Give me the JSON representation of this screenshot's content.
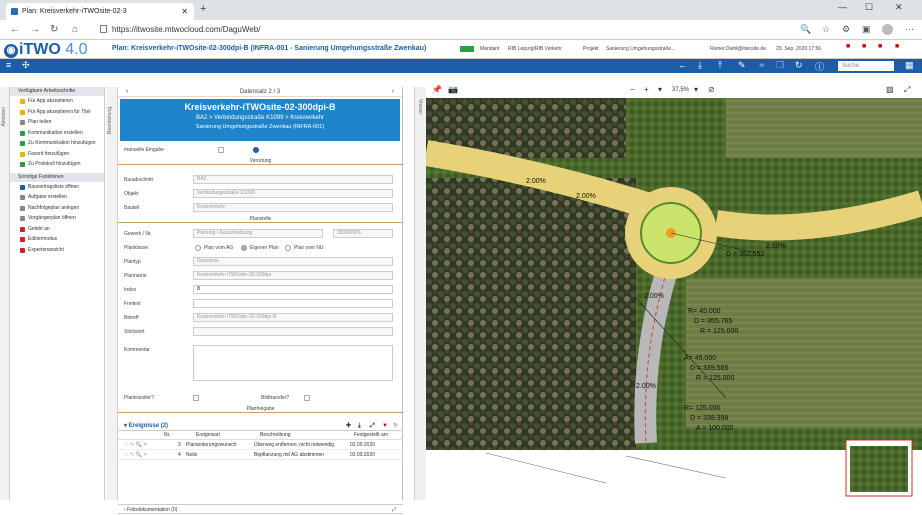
{
  "browser": {
    "tab_title": "Plan: Kreisverkehr-iTWOsite-02-3",
    "url": "https://itwosite.mtwocloud.com/DaguWeb/"
  },
  "app": {
    "logo_text": "iTWO",
    "logo_version": "4.0",
    "plan_title": "Plan: Kreisverkehr-iTWOsite-02-300dpi-B (INFRA-001 - Sanierung Umgehungsstraße Zwenkau)",
    "mandant_label": "Mandant",
    "mandant_value": "RIB Leipzig/RIB Verkehr",
    "projekt_label": "Projekt",
    "projekt_value": "Sanierung Umgehungsstraße...",
    "user": "Reiner.Diehl@itwosite.de",
    "date": "29. Sep. 2020 17:56",
    "search_placeholder": "Suche"
  },
  "left_strip": {
    "label": "Aktionen"
  },
  "form_strip": {
    "label": "Bearbeitung"
  },
  "map_strip": {
    "label": "Viewer"
  },
  "actions": {
    "head1": "Verfügbare Arbeitsschritte",
    "items1": [
      {
        "label": "Für App akzeptieren",
        "color": "#e8b400"
      },
      {
        "label": "Für App akzeptieren für Titel",
        "color": "#e8b400"
      },
      {
        "label": "Plan teilen",
        "color": "#888888"
      },
      {
        "label": "Kommunikation erstellen",
        "color": "#2e9e3c"
      },
      {
        "label": "Zu Kommunikation hinzufügen",
        "color": "#2e9e3c"
      },
      {
        "label": "Favorit hinzufügen",
        "color": "#e8b400"
      },
      {
        "label": "Zu Protokoll hinzufügen",
        "color": "#2e9e3c"
      }
    ],
    "head2": "Sonstige Funktionen",
    "items2": [
      {
        "label": "Bauvertragsliste öffnen",
        "color": "#1c5da8"
      },
      {
        "label": "Aufgabe erstellen",
        "color": "#888888"
      },
      {
        "label": "Nachfolgeplan anlegen",
        "color": "#888888"
      },
      {
        "label": "Vorgängerplan öffnen",
        "color": "#888888"
      },
      {
        "label": "Gelebt an",
        "color": "#cc2222"
      },
      {
        "label": "Editiermodus",
        "color": "#cc2222"
      },
      {
        "label": "Expertenansicht",
        "color": "#cc2222"
      }
    ]
  },
  "form": {
    "datensatz": "Datensatz 2 / 3",
    "title": "Kreisverkehr-iTWOsite-02-300dpi-B",
    "path": "BA2 > Verbindungsstraße K1099 > Kreisverkehr",
    "subtitle": "Sanierung Umgehungsstraße Zwenkau (INFRA-001)",
    "manual_label": "manuelle Eingabe",
    "section_verortung": "Verortung",
    "bauabschnitt_label": "Bauabschnitt",
    "bauabschnitt_value": "BA2",
    "objekt_label": "Objekt",
    "objekt_value": "Verbindungsstraße K1099",
    "bauteil_label": "Bauteil",
    "bauteil_value": "Kreisverkehr",
    "section_planstelle": "Planstelle",
    "gewerk_label": "Gewerk / Nr.",
    "gewerk_value": "Planung / Ausschreibung",
    "gewerk_nr": "3000000%",
    "planklasse_label": "Planklasse",
    "planklasse_opts": [
      "Plan vom AG",
      "Eigener Plan",
      "Plan vom NU"
    ],
    "plantyp_label": "Plantyp",
    "plantyp_value": "Grundriss",
    "planname_label": "Planname",
    "planname_value": "Kreisverkehr-iTWOsite-02-300dpi",
    "index_label": "Index",
    "index_value": "B",
    "freitext_label": "Freitext",
    "betreff_label": "Betreff",
    "betreff_value": "Kreisverkehr-iTWOsite-02-300dpi-B",
    "stichwort_label": "Stichwort",
    "kommentar_label": "Kommentar",
    "plantransfer_label": "Plantransfer?",
    "bildtransfer_label": "Bildtransfer?",
    "section_planfreigabe": "Planfreigabe"
  },
  "events": {
    "title": "Ereignisse (2)",
    "cols": [
      "Nr.",
      "Ereignisart",
      "Beschreibung",
      "Festgestellt am"
    ],
    "rows": [
      {
        "nr": "3",
        "art": "Planänderungswunsch",
        "desc": "Überweg entfernen, nicht notwendig",
        "date": "02.09.2020"
      },
      {
        "nr": "4",
        "art": "Notiz",
        "desc": "Bepflanzung mit AG abstimmen",
        "date": "02.09.2020"
      }
    ],
    "fotodoku": "Fotodokumentation (0)"
  },
  "map": {
    "zoom": "37,5%",
    "annotations": [
      "R= 45.000",
      "D = 355.765",
      "R = 125.000",
      "A= 45.000",
      "D = 339.565",
      "R = 125.000",
      "R= 125.000",
      "D = 338.398",
      "A = 100.000",
      "D = 352.552",
      "2.00%",
      "2.00%",
      "2.00%",
      "2.00%",
      "2.00%"
    ]
  },
  "colors": {
    "brand": "#1c5da8",
    "header_blue": "#1e84cc",
    "road": "#e7d27a"
  }
}
